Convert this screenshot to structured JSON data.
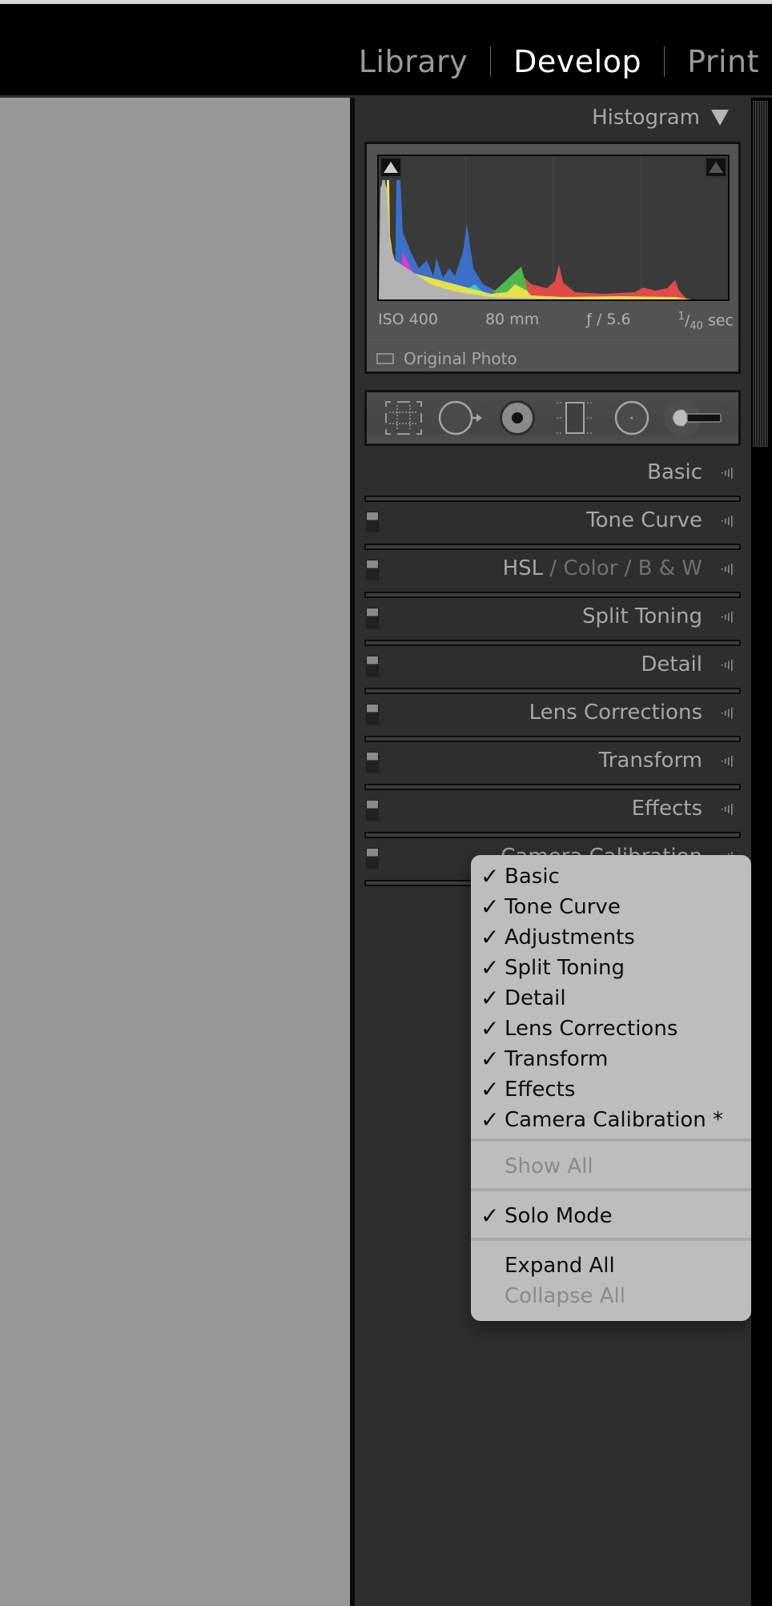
{
  "navbar": {
    "modules": [
      {
        "label": "Library",
        "active": false
      },
      {
        "label": "Develop",
        "active": true
      },
      {
        "label": "Print",
        "active": false
      }
    ]
  },
  "histogram": {
    "title": "Histogram",
    "exif": {
      "iso": "ISO 400",
      "focal_length": "80 mm",
      "aperture": "ƒ / 5.6",
      "shutter_num": "1",
      "shutter_den": "40",
      "shutter_unit": "sec"
    },
    "original_photo_label": "Original Photo",
    "original_photo_checked": false,
    "colors": {
      "gray": "#b3b3b3",
      "blue": "#3d6fc9",
      "magenta": "#d83ccf",
      "cyan": "#33c9cf",
      "green": "#4cb84c",
      "yellow": "#e8e04a",
      "red": "#e04a4a"
    }
  },
  "tools": [
    {
      "name": "crop-overlay"
    },
    {
      "name": "spot-removal"
    },
    {
      "name": "red-eye-correction"
    },
    {
      "name": "graduated-filter"
    },
    {
      "name": "radial-filter"
    },
    {
      "name": "adjustment-brush"
    }
  ],
  "sections": [
    {
      "label": "Basic",
      "has_switch": false
    },
    {
      "label": "Tone Curve",
      "has_switch": true
    },
    {
      "label": "HSL",
      "label_parts": [
        "HSL",
        " / ",
        "Color",
        " / ",
        "B & W"
      ],
      "has_switch": true
    },
    {
      "label": "Split Toning",
      "has_switch": true
    },
    {
      "label": "Detail",
      "has_switch": true
    },
    {
      "label": "Lens Corrections",
      "has_switch": true
    },
    {
      "label": "Transform",
      "has_switch": true
    },
    {
      "label": "Effects",
      "has_switch": true
    },
    {
      "label": "Camera Calibration",
      "has_switch": true
    }
  ],
  "context_menu": {
    "panel_items": [
      {
        "label": "Basic",
        "checked": true
      },
      {
        "label": "Tone Curve",
        "checked": true
      },
      {
        "label": "Adjustments",
        "checked": true
      },
      {
        "label": "Split Toning",
        "checked": true
      },
      {
        "label": "Detail",
        "checked": true
      },
      {
        "label": "Lens Corrections",
        "checked": true
      },
      {
        "label": "Transform",
        "checked": true
      },
      {
        "label": "Effects",
        "checked": true
      },
      {
        "label": "Camera Calibration *",
        "checked": true
      }
    ],
    "show_all": {
      "label": "Show All",
      "enabled": false
    },
    "solo_mode": {
      "label": "Solo Mode",
      "checked": true
    },
    "expand_all": {
      "label": "Expand All",
      "enabled": true
    },
    "collapse_all": {
      "label": "Collapse All",
      "enabled": false
    },
    "checkmark": "✓"
  }
}
